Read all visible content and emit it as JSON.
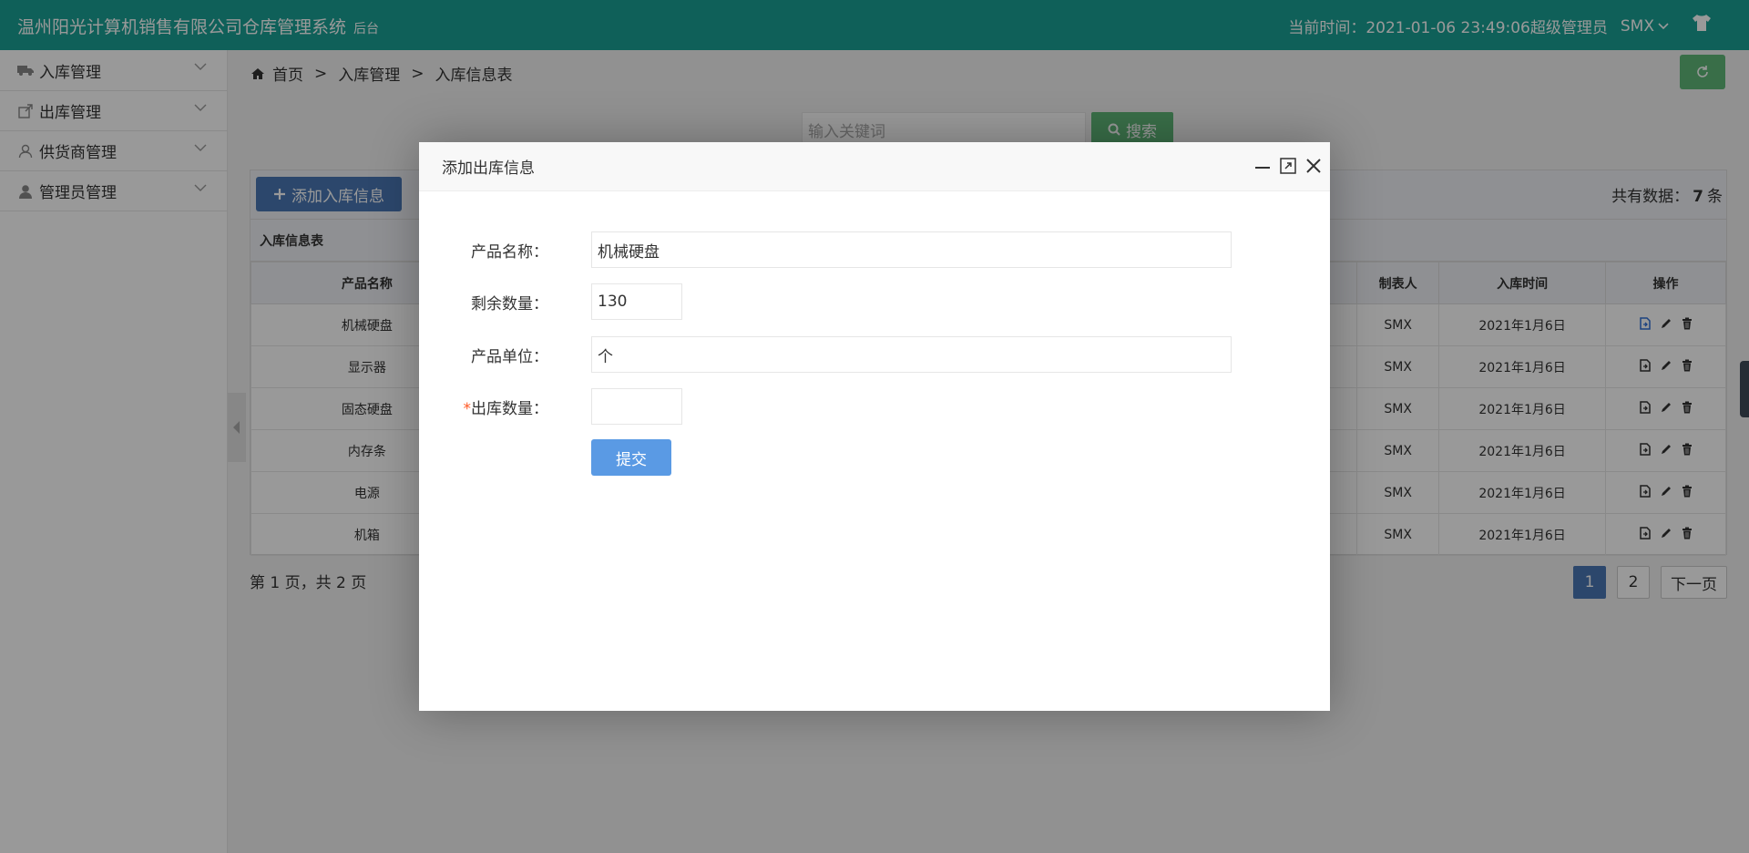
{
  "header": {
    "title": "温州阳光计算机销售有限公司仓库管理系统",
    "subtitle": "后台",
    "time_text": "当前时间：2021-01-06 23:49:06",
    "role": "超级管理员",
    "user": "SMX"
  },
  "sidebar": {
    "items": [
      {
        "label": "入库管理",
        "icon": "truck-icon"
      },
      {
        "label": "出库管理",
        "icon": "export-icon"
      },
      {
        "label": "供货商管理",
        "icon": "user-outline-icon"
      },
      {
        "label": "管理员管理",
        "icon": "user-icon"
      }
    ]
  },
  "breadcrumb": {
    "home": "首页",
    "sep": ">",
    "level1": "入库管理",
    "level2": "入库信息表"
  },
  "search": {
    "placeholder": "输入关键词",
    "button": "搜索"
  },
  "toolbar": {
    "add_label": "添加入库信息",
    "total_prefix": "共有数据：",
    "total_count": "7",
    "total_suffix": "条"
  },
  "table": {
    "caption": "入库信息表",
    "headers": [
      "产品名称",
      "制表人",
      "入库时间",
      "操作"
    ],
    "rows": [
      {
        "name": "机械硬盘",
        "maker": "SMX",
        "date": "2021年1月6日"
      },
      {
        "name": "显示器",
        "maker": "SMX",
        "date": "2021年1月6日"
      },
      {
        "name": "固态硬盘",
        "maker": "SMX",
        "date": "2021年1月6日"
      },
      {
        "name": "内存条",
        "maker": "SMX",
        "date": "2021年1月6日"
      },
      {
        "name": "电源",
        "maker": "SMX",
        "date": "2021年1月6日"
      },
      {
        "name": "机箱",
        "maker": "SMX",
        "date": "2021年1月6日"
      }
    ]
  },
  "pagination": {
    "info": "第 1 页，共 2 页",
    "pages": [
      "1",
      "2"
    ],
    "next": "下一页"
  },
  "modal": {
    "title": "添加出库信息",
    "fields": [
      {
        "label": "产品名称：",
        "value": "机械硬盘",
        "required": false
      },
      {
        "label": "剩余数量：",
        "value": "130",
        "required": false
      },
      {
        "label": "产品单位：",
        "value": "个",
        "required": false
      },
      {
        "label": "出库数量：",
        "value": "",
        "required": true
      }
    ],
    "required_mark": "*",
    "submit": "提交"
  },
  "colors": {
    "header": "#1aa094",
    "green_button": "#5fb878",
    "blue_button": "#4a77b4",
    "submit_button": "#5a9ae4"
  }
}
